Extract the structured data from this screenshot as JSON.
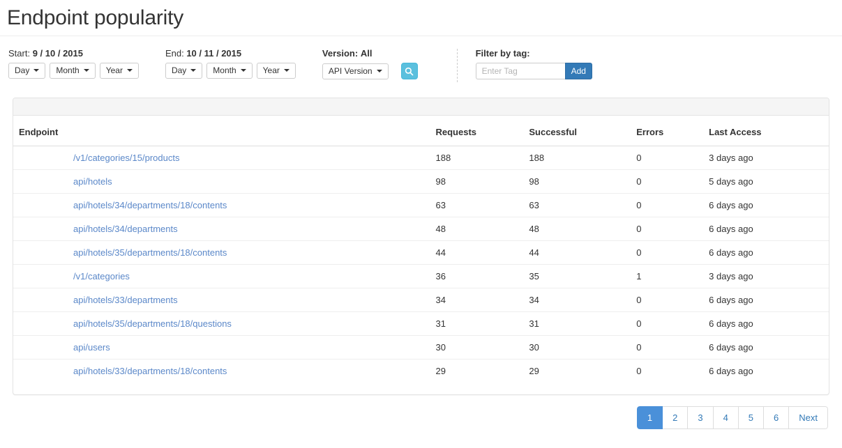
{
  "header": {
    "title": "Endpoint popularity"
  },
  "toolbar": {
    "start": {
      "label_prefix": "Start:",
      "value": "9 / 10 / 2015",
      "day_label": "Day",
      "month_label": "Month",
      "year_label": "Year"
    },
    "end": {
      "label_prefix": "End:",
      "value": "10 / 11 / 2015",
      "day_label": "Day",
      "month_label": "Month",
      "year_label": "Year"
    },
    "version": {
      "label_prefix": "Version:",
      "value": "All",
      "dropdown_label": "API Version"
    },
    "search_icon": "search-icon",
    "tag": {
      "label": "Filter by tag:",
      "placeholder": "Enter Tag",
      "value": "",
      "add_label": "Add"
    }
  },
  "table": {
    "columns": [
      "Endpoint",
      "Requests",
      "Successful",
      "Errors",
      "Last Access"
    ],
    "rows": [
      {
        "endpoint": "/v1/categories/15/products",
        "requests": "188",
        "successful": "188",
        "errors": "0",
        "last_access": "3 days ago"
      },
      {
        "endpoint": "api/hotels",
        "requests": "98",
        "successful": "98",
        "errors": "0",
        "last_access": "5 days ago"
      },
      {
        "endpoint": "api/hotels/34/departments/18/contents",
        "requests": "63",
        "successful": "63",
        "errors": "0",
        "last_access": "6 days ago"
      },
      {
        "endpoint": "api/hotels/34/departments",
        "requests": "48",
        "successful": "48",
        "errors": "0",
        "last_access": "6 days ago"
      },
      {
        "endpoint": "api/hotels/35/departments/18/contents",
        "requests": "44",
        "successful": "44",
        "errors": "0",
        "last_access": "6 days ago"
      },
      {
        "endpoint": "/v1/categories",
        "requests": "36",
        "successful": "35",
        "errors": "1",
        "last_access": "3 days ago"
      },
      {
        "endpoint": "api/hotels/33/departments",
        "requests": "34",
        "successful": "34",
        "errors": "0",
        "last_access": "6 days ago"
      },
      {
        "endpoint": "api/hotels/35/departments/18/questions",
        "requests": "31",
        "successful": "31",
        "errors": "0",
        "last_access": "6 days ago"
      },
      {
        "endpoint": "api/users",
        "requests": "30",
        "successful": "30",
        "errors": "0",
        "last_access": "6 days ago"
      },
      {
        "endpoint": "api/hotels/33/departments/18/contents",
        "requests": "29",
        "successful": "29",
        "errors": "0",
        "last_access": "6 days ago"
      }
    ]
  },
  "pagination": {
    "pages": [
      "1",
      "2",
      "3",
      "4",
      "5",
      "6"
    ],
    "next_label": "Next",
    "active_index": 0
  },
  "colors": {
    "link": "#5b88c9",
    "primary": "#337ab7",
    "info": "#5bc0de",
    "active_page": "#4a90d9"
  }
}
